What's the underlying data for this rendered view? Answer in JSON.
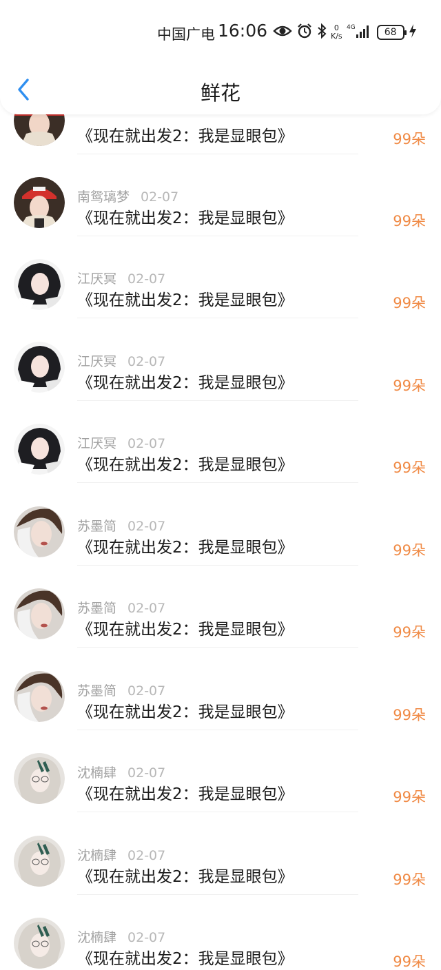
{
  "status": {
    "carrier": "中国广电",
    "time": "16:06",
    "net_speed_value": "0",
    "net_speed_unit": "K/s",
    "net_type": "4G",
    "battery": "68"
  },
  "nav": {
    "title": "鲜花"
  },
  "items": [
    {
      "name": "",
      "date": "",
      "work": "《现在就出发2：我是显眼包》",
      "count": "99朵"
    },
    {
      "name": "南鸳璃梦",
      "date": "02-07",
      "work": "《现在就出发2：我是显眼包》",
      "count": "99朵"
    },
    {
      "name": "江厌冥",
      "date": "02-07",
      "work": "《现在就出发2：我是显眼包》",
      "count": "99朵"
    },
    {
      "name": "江厌冥",
      "date": "02-07",
      "work": "《现在就出发2：我是显眼包》",
      "count": "99朵"
    },
    {
      "name": "江厌冥",
      "date": "02-07",
      "work": "《现在就出发2：我是显眼包》",
      "count": "99朵"
    },
    {
      "name": "苏墨简",
      "date": "02-07",
      "work": "《现在就出发2：我是显眼包》",
      "count": "99朵"
    },
    {
      "name": "苏墨简",
      "date": "02-07",
      "work": "《现在就出发2：我是显眼包》",
      "count": "99朵"
    },
    {
      "name": "苏墨简",
      "date": "02-07",
      "work": "《现在就出发2：我是显眼包》",
      "count": "99朵"
    },
    {
      "name": "沈楠肆",
      "date": "02-07",
      "work": "《现在就出发2：我是显眼包》",
      "count": "99朵"
    },
    {
      "name": "沈楠肆",
      "date": "02-07",
      "work": "《现在就出发2：我是显眼包》",
      "count": "99朵"
    },
    {
      "name": "沈楠肆",
      "date": "02-07",
      "work": "《现在就出发2：我是显眼包》",
      "count": "99朵"
    }
  ],
  "colors": {
    "accent_back": "#2f8ff0",
    "count": "#f08a45",
    "meta": "#a2a2a2"
  }
}
